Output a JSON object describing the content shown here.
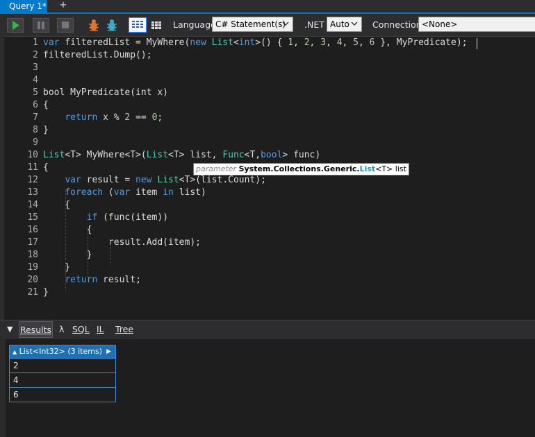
{
  "tabs": {
    "active_label": "Query 1*",
    "new_tab_label": "+"
  },
  "toolbar": {
    "language_label": "Language",
    "language_value": "C# Statement(s)",
    "dotnet_label": ".NET",
    "dotnet_value": "Auto",
    "connection_label": "Connection",
    "connection_value": "<None>",
    "icons": [
      "run-icon",
      "pause-icon",
      "stop-icon",
      "bug-icon",
      "bug-icon",
      "grid-results-icon",
      "data-grid-icon"
    ]
  },
  "editor": {
    "lines": [
      {
        "n": "1",
        "html": "<span class=\"kw\">var</span> filteredList = MyWhere(<span class=\"kw\">new</span> <span class=\"ty\">List</span>&lt;<span class=\"kw\">int</span>&gt;() { <span class=\"num\">1</span>, <span class=\"num\">2</span>, <span class=\"num\">3</span>, <span class=\"num\">4</span>, <span class=\"num\">5</span>, <span class=\"num\">6</span> }, MyPredicate);"
      },
      {
        "n": "2",
        "html": "filteredList.Dump();"
      },
      {
        "n": "3",
        "html": ""
      },
      {
        "n": "4",
        "html": ""
      },
      {
        "n": "5",
        "html": "bool MyPredicate(int x)"
      },
      {
        "n": "6",
        "html": "{"
      },
      {
        "n": "7",
        "html": "    <span class=\"kw\">return</span> x % <span class=\"num\">2</span> == <span class=\"num\">0</span>;"
      },
      {
        "n": "8",
        "html": "}"
      },
      {
        "n": "9",
        "html": ""
      },
      {
        "n": "10",
        "html": "<span class=\"ty\">List</span>&lt;T&gt; MyWhere&lt;T&gt;(<span class=\"ty\">List</span>&lt;T&gt; list, <span class=\"ty\">Func</span>&lt;T,<span class=\"kw\">bool</span>&gt; func)"
      },
      {
        "n": "11",
        "html": "{"
      },
      {
        "n": "12",
        "html": "    <span class=\"kw\">var</span> result = <span class=\"kw\">new</span> <span class=\"ty\">List</span>&lt;T&gt;(list.Count);"
      },
      {
        "n": "13",
        "html": "    <span class=\"kw\">foreach</span> (<span class=\"kw\">var</span> item <span class=\"kw\">in</span> list)"
      },
      {
        "n": "14",
        "html": "    {"
      },
      {
        "n": "15",
        "html": "        <span class=\"kw\">if</span> (func(item))"
      },
      {
        "n": "16",
        "html": "        {"
      },
      {
        "n": "17",
        "html": "            result.Add(item);"
      },
      {
        "n": "18",
        "html": "        }"
      },
      {
        "n": "19",
        "html": "    }"
      },
      {
        "n": "20",
        "html": "    <span class=\"kw\">return</span> result;"
      },
      {
        "n": "21",
        "html": "}"
      }
    ]
  },
  "tooltip": {
    "param_word": "parameter",
    "namespace": "System.Collections.Generic.",
    "type": "List",
    "generic": "<T>",
    "name": " list"
  },
  "results_tabs": {
    "collapse_glyph": "▼",
    "results": "Results",
    "lambda": "λ",
    "sql": "SQL",
    "il": "IL",
    "tree": "Tree"
  },
  "results": {
    "header": "List<Int32> (3 items)",
    "rows": [
      "2",
      "4",
      "6"
    ]
  },
  "colors": {
    "accent": "#007acc",
    "keyword": "#569cd6",
    "number": "#b5cea8",
    "type": "#4ec9b0",
    "result_header": "#1f6fb5"
  }
}
